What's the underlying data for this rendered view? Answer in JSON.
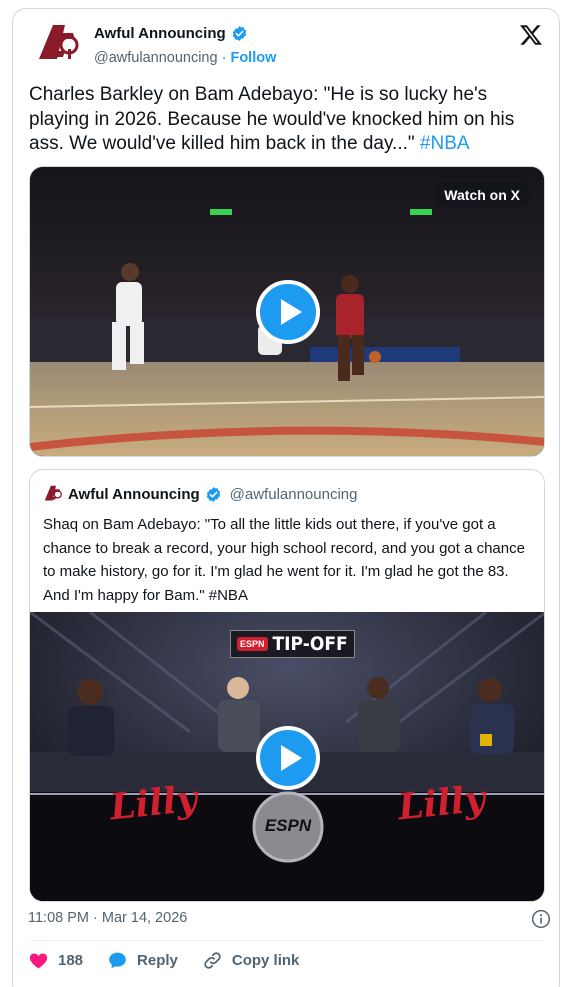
{
  "author": {
    "name": "Awful Announcing",
    "handle": "@awfulannouncing",
    "separator": "·",
    "follow_label": "Follow",
    "avatar_icon": "awful-announcing-logo",
    "verified_icon": "verified-badge-icon",
    "brand_color": "#8b1a2b"
  },
  "tweet": {
    "text": "Charles Barkley on Bam Adebayo: \"He is so lucky he's playing in 2026. Because he would've knocked him on his ass. We would've killed him back in the day...\" ",
    "hashtag": "#NBA"
  },
  "video": {
    "watch_label": "Watch on X",
    "play_icon": "play-icon"
  },
  "quote": {
    "name": "Awful Announcing",
    "handle": "@awfulannouncing",
    "text": "Shaq on Bam Adebayo: \"To all the little kids out there, if you've got a chance to break a record, your high school record, and you got a chance to make history, go for it. I'm glad he went for it. I'm glad he got the 83. And I'm happy for Bam.\" #NBA",
    "video_banner": "TIP-OFF",
    "video_banner_brand": "ESPN",
    "video_sponsor": "Lilly",
    "video_center_logo": "ESPN"
  },
  "footer": {
    "timestamp": "11:08 PM · Mar 14, 2026",
    "likes": "188",
    "reply_label": "Reply",
    "copy_link_label": "Copy link"
  },
  "colors": {
    "accent": "#1d9bf0",
    "like": "#f91880",
    "secondary_text": "#536471"
  }
}
